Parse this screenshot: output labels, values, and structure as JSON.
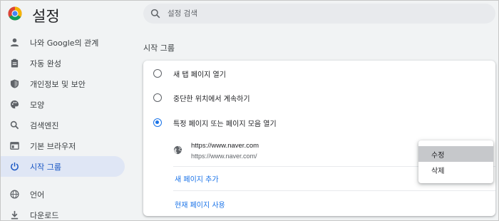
{
  "header": {
    "title": "설정",
    "logo_icon": "chrome-logo-icon"
  },
  "search": {
    "placeholder": "설정 검색",
    "icon": "search-icon"
  },
  "sidebar": {
    "items": [
      {
        "label": "나와 Google의 관계",
        "icon": "person-icon"
      },
      {
        "label": "자동 완성",
        "icon": "clipboard-icon"
      },
      {
        "label": "개인정보 및 보안",
        "icon": "shield-icon"
      },
      {
        "label": "모양",
        "icon": "palette-icon"
      },
      {
        "label": "검색엔진",
        "icon": "search-icon"
      },
      {
        "label": "기본 브라우저",
        "icon": "browser-window-icon"
      },
      {
        "label": "시작 그룹",
        "icon": "power-icon",
        "active": true
      },
      {
        "label": "언어",
        "icon": "globe-icon"
      },
      {
        "label": "다운로드",
        "icon": "download-icon"
      }
    ]
  },
  "main": {
    "section_title": "시작 그룹",
    "options": [
      {
        "label": "새 탭 페이지 열기",
        "checked": false
      },
      {
        "label": "중단한 위치에서 계속하기",
        "checked": false
      },
      {
        "label": "특정 페이지 또는 페이지 모음 열기",
        "checked": true
      }
    ],
    "page_entry": {
      "title": "https://www.naver.com",
      "url": "https://www.naver.com/"
    },
    "add_page_label": "새 페이지 추가",
    "use_current_label": "현재 페이지 사용"
  },
  "context_menu": {
    "items": [
      "수정",
      "삭제"
    ]
  },
  "colors": {
    "accent": "#1a73e8",
    "active_nav_bg": "#dfe6f5",
    "page_bg": "#f1f3f4"
  }
}
